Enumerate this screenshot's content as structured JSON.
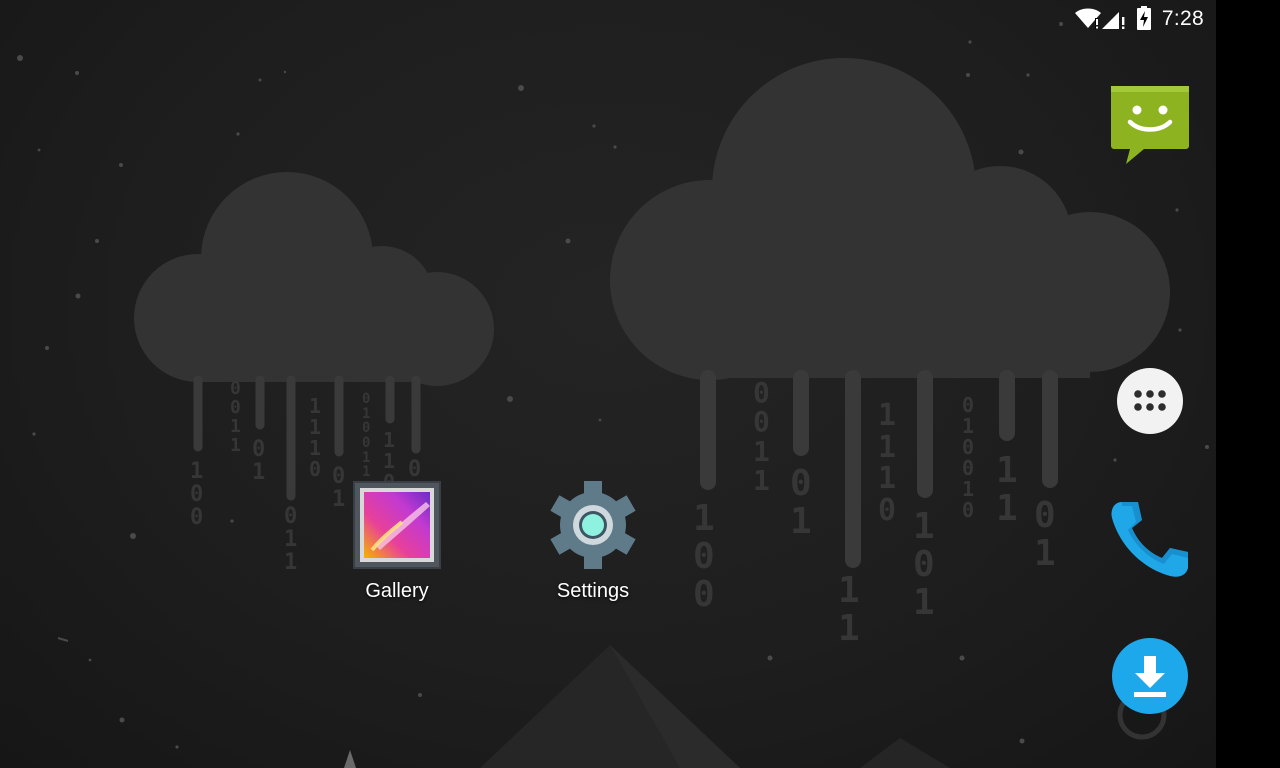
{
  "status_bar": {
    "time": "7:28",
    "icons": [
      "wifi-alert-icon",
      "cell-signal-alert-icon",
      "battery-charging-icon"
    ]
  },
  "desktop": {
    "apps": [
      {
        "label": "Gallery",
        "icon": "gallery-icon"
      },
      {
        "label": "Settings",
        "icon": "settings-gear-icon"
      }
    ]
  },
  "dock": {
    "items": [
      {
        "name": "Messaging",
        "icon": "messaging-icon",
        "color": "#8DB420"
      },
      {
        "name": "Apps",
        "icon": "app-drawer-icon",
        "color": "#F2F2F2"
      },
      {
        "name": "Phone",
        "icon": "phone-icon",
        "color": "#1FA7E8"
      },
      {
        "name": "Downloads",
        "icon": "download-icon",
        "color": "#1EA8EC"
      }
    ]
  },
  "wallpaper": {
    "binary_rain_left": [
      "100",
      "0011",
      "01",
      "011",
      "1110",
      "01",
      "010011",
      "110",
      "0"
    ],
    "binary_rain_right": [
      "100",
      "0011",
      "01",
      "11",
      "1110",
      "101",
      "010010",
      "11",
      "01"
    ]
  }
}
